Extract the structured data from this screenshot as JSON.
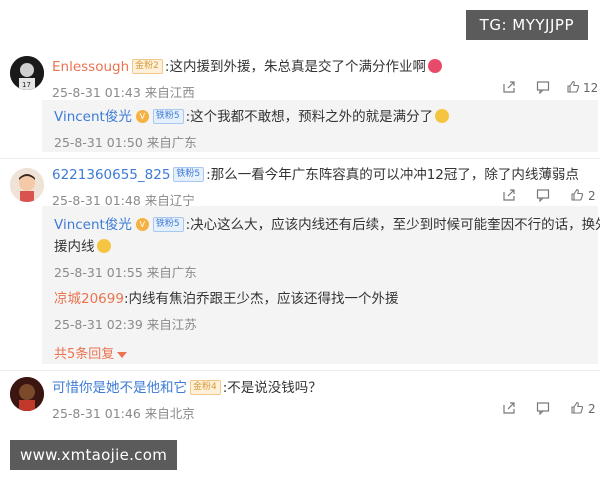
{
  "watermarks": {
    "top": "TG: MYYJJPP",
    "bottom": "www.xmtaojie.com"
  },
  "comments": [
    {
      "user": "Enlessough",
      "badge": "金粉2",
      "text": ":这内援到外援，朱总真是交了个满分作业啊",
      "meta": "25-8-31 01:43 来自江西",
      "likes": "12",
      "replies": [
        {
          "user": "Vincent俊光",
          "badge": "铁粉5",
          "text": ":这个我都不敢想，预料之外的就是满分了",
          "meta": "25-8-31 01:50 来自广东"
        }
      ]
    },
    {
      "user": "6221360655_825",
      "badge": "铁粉5",
      "text": ":那么一看今年广东阵容真的可以冲冲12冠了，除了内线薄弱点",
      "meta": "25-8-31 01:48 来自辽宁",
      "likes": "2",
      "replies": [
        {
          "user": "Vincent俊光",
          "badge": "铁粉5",
          "text": ":决心这么大，应该内线还有后续，至少到时候可能奎因不行的话，换外",
          "text2": "援内线",
          "meta": "25-8-31 01:55 来自广东"
        },
        {
          "user": "凉城20699",
          "text": ":内线有焦泊乔跟王少杰，应该还得找一个外援",
          "meta": "25-8-31 02:39 来自江苏"
        }
      ],
      "more": "共5条回复"
    },
    {
      "user": "可惜你是她不是他和它",
      "badge": "金粉4",
      "text": ":不是说没钱吗？",
      "meta": "25-8-31 01:46 来自北京",
      "likes": "2"
    }
  ],
  "colors": {
    "username_orange": "#eb7350",
    "username_blue": "#3d7bd6",
    "reply_bg": "#f4f4f4"
  },
  "icons": [
    "share-icon",
    "comment-icon",
    "like-icon",
    "emoji-icon"
  ]
}
